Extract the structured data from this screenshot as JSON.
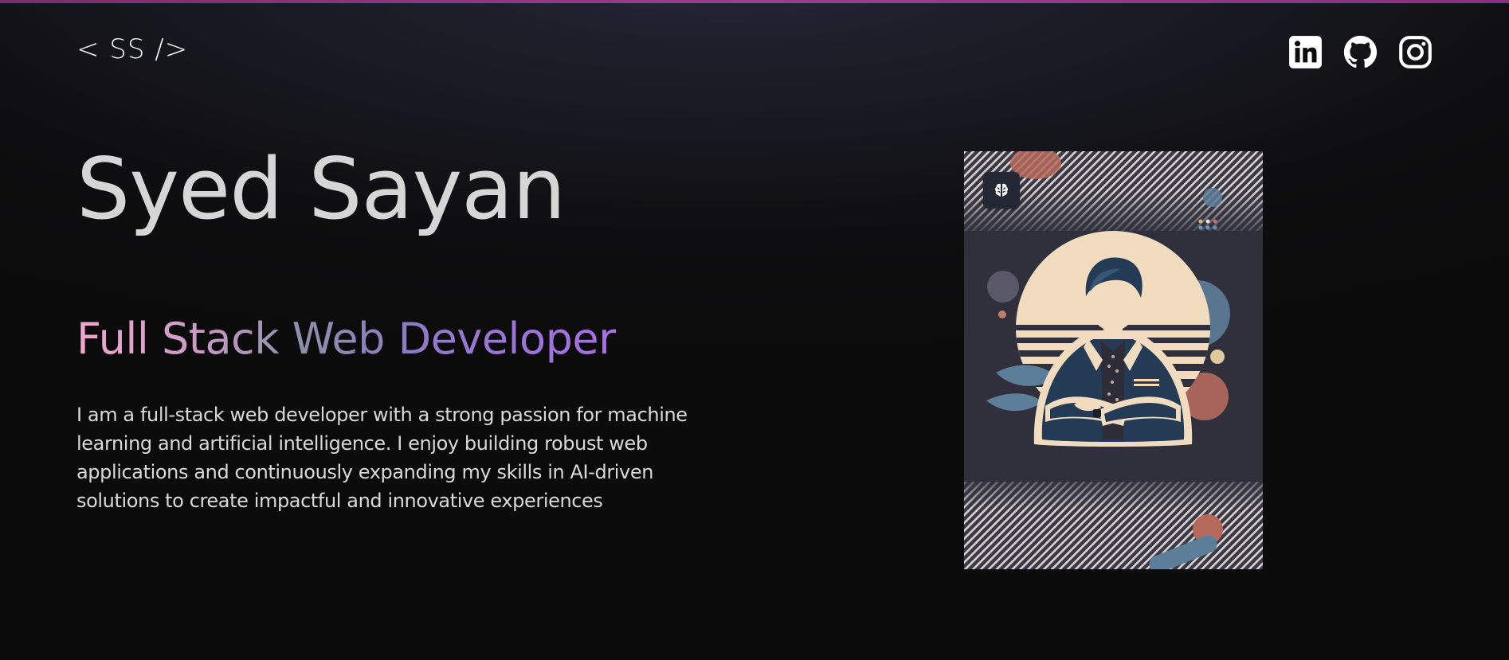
{
  "header": {
    "logo_text": "< SS />",
    "social_links": [
      {
        "name": "LinkedIn",
        "icon": "linkedin-icon"
      },
      {
        "name": "GitHub",
        "icon": "github-icon"
      },
      {
        "name": "Instagram",
        "icon": "instagram-icon"
      }
    ]
  },
  "hero": {
    "name": "Syed Sayan",
    "role": "Full Stack Web Developer",
    "bio": "I am a full-stack web developer with a strong passion for machine learning and artificial intelligence. I enjoy building robust web applications and continuously expanding my skills in AI-driven solutions to create impactful and innovative experiences",
    "photo_badge_icon": "brain-icon"
  },
  "colors": {
    "accent_bar": "#a03c8f",
    "gradient_start": "#f3a8cf",
    "gradient_end": "#a86fe6",
    "background": "#0b0b0b"
  }
}
